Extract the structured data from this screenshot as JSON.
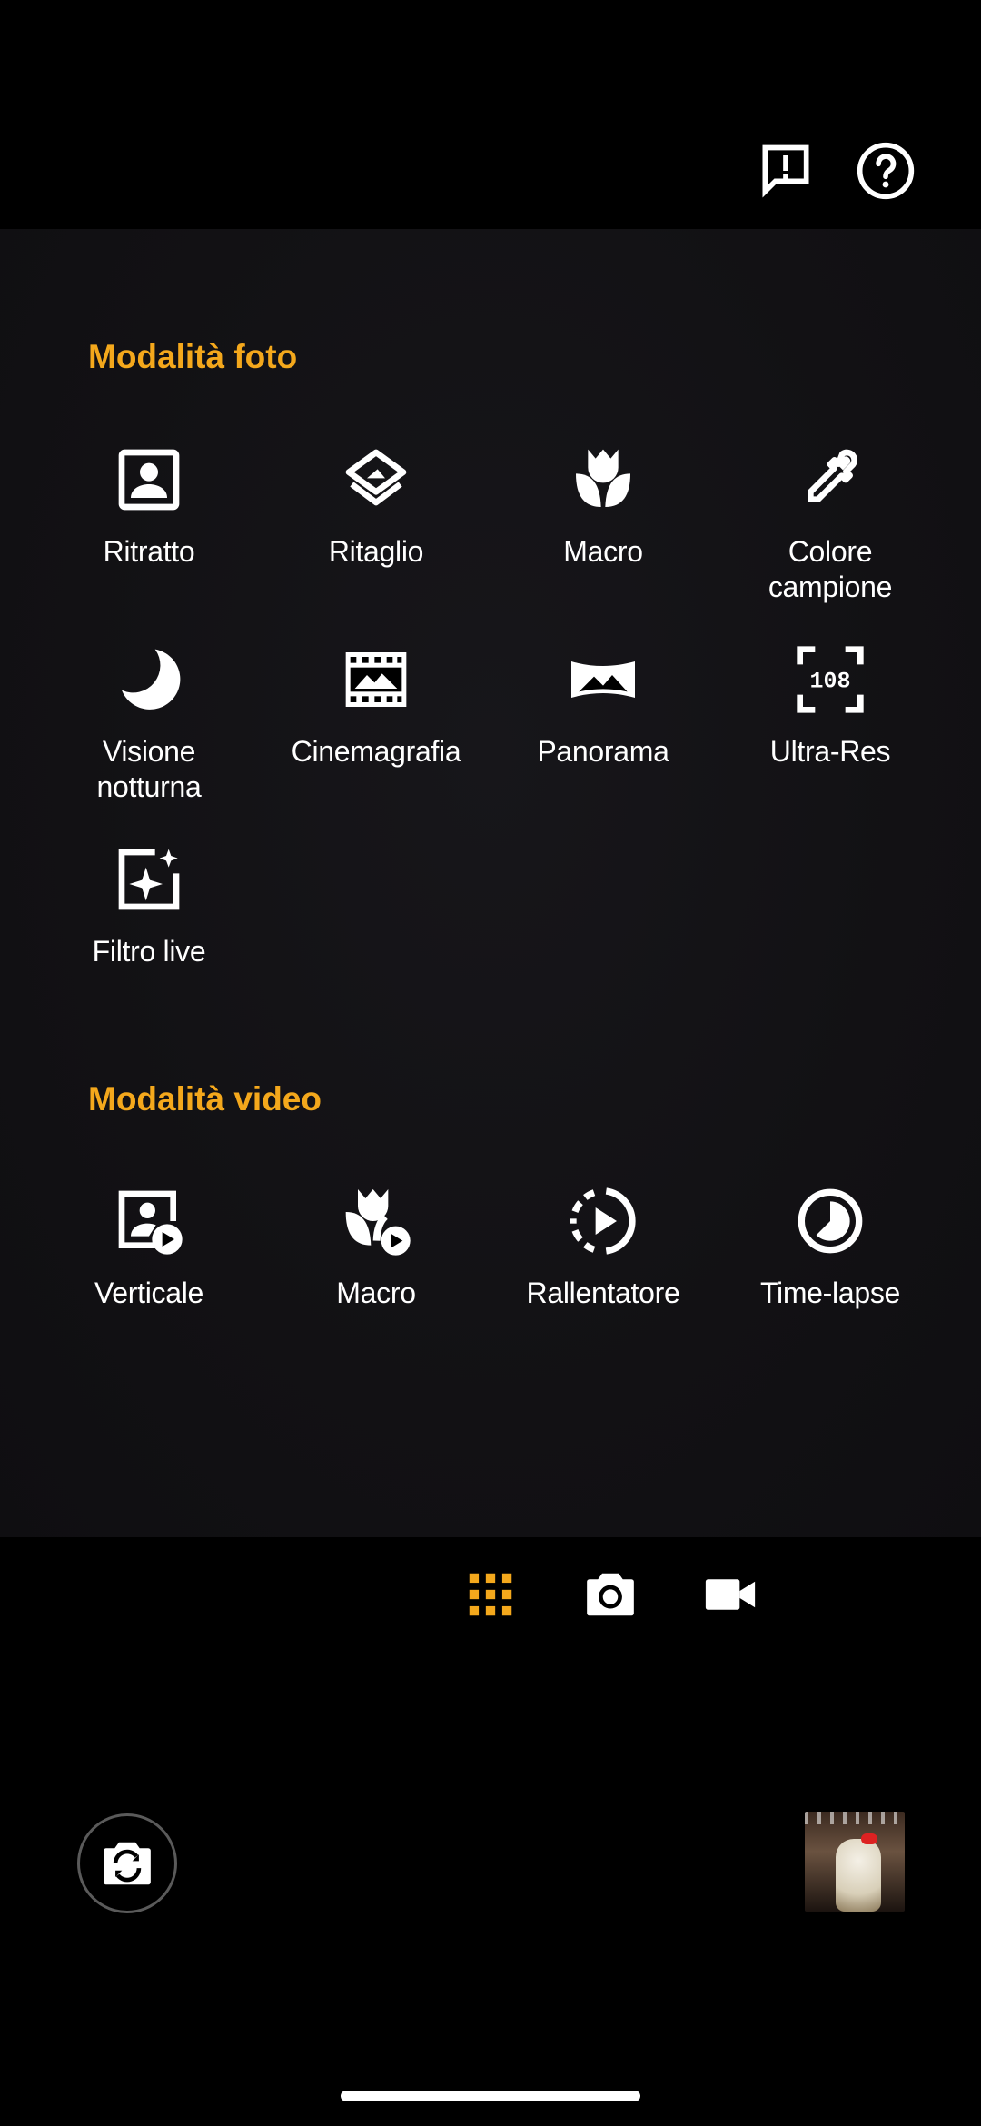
{
  "colors": {
    "accent": "#f4a81c",
    "background": "#000000",
    "panel": "#131215",
    "text": "#ffffff"
  },
  "top_bar": {
    "feedback_icon": "feedback-icon",
    "help_icon": "help-icon"
  },
  "photo_modes": {
    "title": "Modalità foto",
    "items": [
      {
        "label": "Ritratto",
        "icon": "portrait-icon"
      },
      {
        "label": "Ritaglio",
        "icon": "cutout-icon"
      },
      {
        "label": "Macro",
        "icon": "macro-flower-icon"
      },
      {
        "label": "Colore\ncampione",
        "icon": "eyedropper-icon"
      },
      {
        "label": "Visione\nnotturna",
        "icon": "moon-icon"
      },
      {
        "label": "Cinemagrafia",
        "icon": "film-icon"
      },
      {
        "label": "Panorama",
        "icon": "panorama-icon"
      },
      {
        "label": "Ultra-Res",
        "icon": "ultra-res-108-icon"
      },
      {
        "label": "Filtro live",
        "icon": "sparkle-filter-icon"
      }
    ]
  },
  "video_modes": {
    "title": "Modalità video",
    "items": [
      {
        "label": "Verticale",
        "icon": "portrait-video-icon"
      },
      {
        "label": "Macro",
        "icon": "macro-video-icon"
      },
      {
        "label": "Rallentatore",
        "icon": "slow-motion-icon"
      },
      {
        "label": "Time-lapse",
        "icon": "timelapse-icon"
      }
    ]
  },
  "mode_bar": {
    "grid_icon": "grid-icon",
    "photo_icon": "camera-icon",
    "video_icon": "video-camera-icon",
    "active": "grid"
  },
  "controls": {
    "switch_camera_icon": "switch-camera-icon",
    "gallery_thumbnail": "last-photo-thumbnail"
  }
}
